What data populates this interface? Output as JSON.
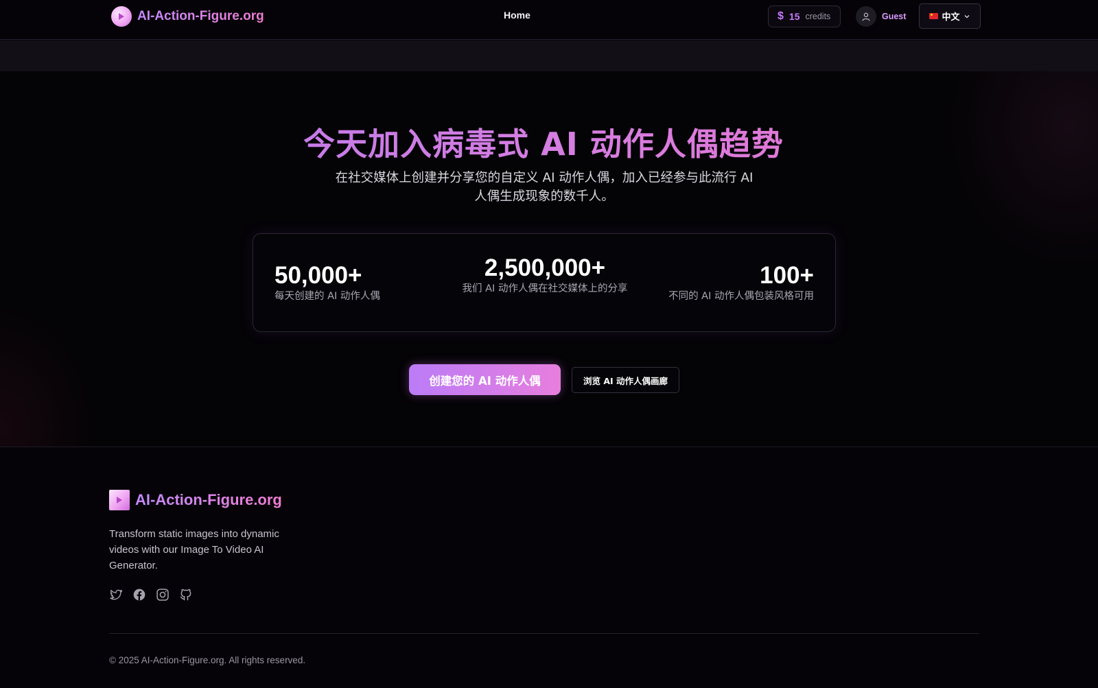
{
  "navbar": {
    "brand": "AI-Action-Figure.org",
    "home": "Home",
    "credits_count": "15",
    "credits_label": "credits",
    "user_name": "Guest",
    "language": "中文"
  },
  "hero": {
    "title": "今天加入病毒式 AI 动作人偶趋势",
    "subtitle": "在社交媒体上创建并分享您的自定义 AI 动作人偶，加入已经参与此流行 AI 人偶生成现象的数千人。",
    "stats": [
      {
        "value": "50,000+",
        "label": "每天创建的 AI 动作人偶"
      },
      {
        "value": "2,500,000+",
        "label": "我们 AI 动作人偶在社交媒体上的分享"
      },
      {
        "value": "100+",
        "label": "不同的 AI 动作人偶包装风格可用"
      }
    ],
    "primary_button": "创建您的 AI 动作人偶",
    "secondary_button": "浏览 AI 动作人偶画廊"
  },
  "footer": {
    "brand": "AI-Action-Figure.org",
    "description": "Transform static images into dynamic videos with our Image To Video AI Generator.",
    "socials": [
      "twitter-icon",
      "facebook-icon",
      "instagram-icon",
      "github-icon"
    ],
    "copyright": "© 2025 AI-Action-Figure.org. All rights reserved."
  },
  "colors": {
    "accent_purple": "#c97bff",
    "accent_pink": "#ee72c9",
    "background": "#050307"
  }
}
